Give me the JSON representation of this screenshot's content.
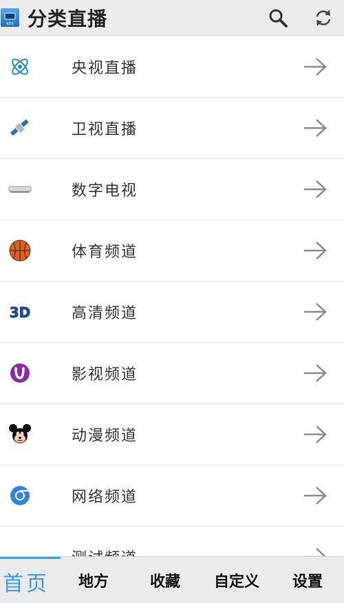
{
  "header": {
    "title": "分类直播",
    "logo_text": "KDS",
    "search_icon": "search-icon",
    "refresh_icon": "refresh-icon"
  },
  "categories": [
    {
      "label": "央视直播",
      "icon": "atom-icon"
    },
    {
      "label": "卫视直播",
      "icon": "satellite-icon"
    },
    {
      "label": "数字电视",
      "icon": "set-top-box-icon"
    },
    {
      "label": "体育频道",
      "icon": "basketball-icon"
    },
    {
      "label": "高清频道",
      "icon": "3d-icon"
    },
    {
      "label": "影视频道",
      "icon": "film-logo-icon"
    },
    {
      "label": "动漫频道",
      "icon": "mickey-icon"
    },
    {
      "label": "网络频道",
      "icon": "chrome-icon"
    },
    {
      "label": "测试频道",
      "icon": "test-icon"
    }
  ],
  "tabs": [
    {
      "label": "首页",
      "active": true
    },
    {
      "label": "地方",
      "active": false
    },
    {
      "label": "收藏",
      "active": false
    },
    {
      "label": "自定义",
      "active": false
    },
    {
      "label": "设置",
      "active": false
    }
  ],
  "colors": {
    "accent": "#3b9de2",
    "header_bg": "#ececec",
    "arrow": "#8a8a8a"
  }
}
